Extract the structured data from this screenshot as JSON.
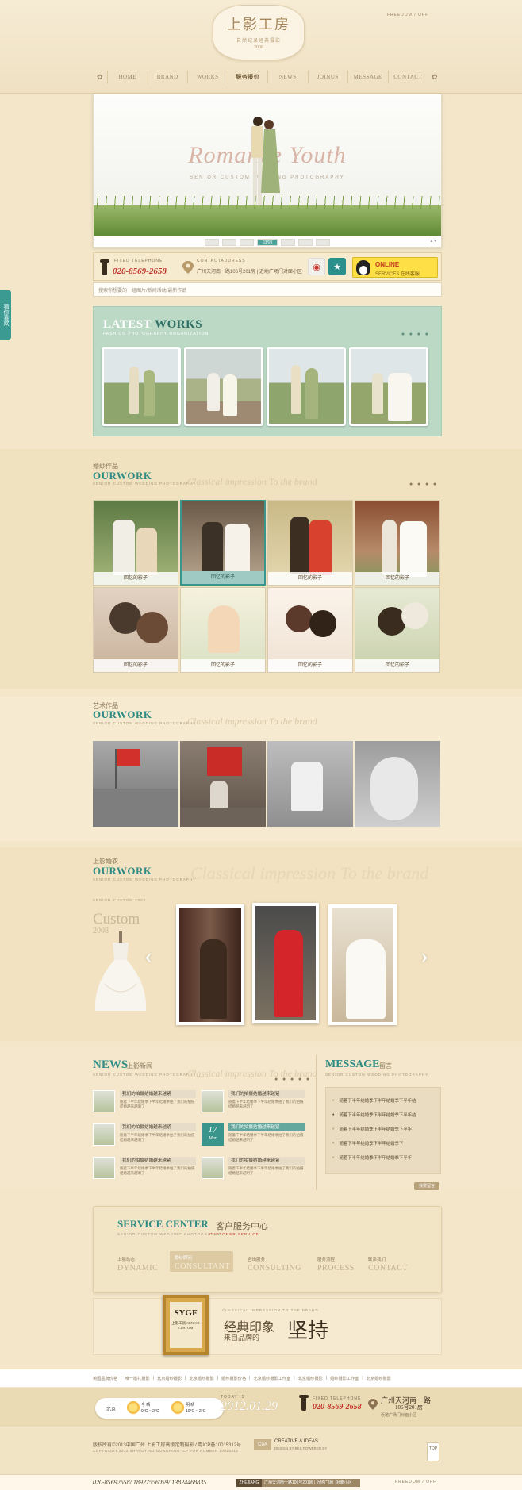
{
  "header": {
    "logo_title": "上影工房",
    "logo_subtitle": "自然纪录经典摄影",
    "logo_year": "2008",
    "lang": "FREEDOM / OFF"
  },
  "nav": {
    "left_icon": "home-deco-icon",
    "items": [
      {
        "label": "HOME"
      },
      {
        "label": "BRAND"
      },
      {
        "label": "WORKS"
      },
      {
        "label": "服务报价"
      },
      {
        "label": "NEWS"
      },
      {
        "label": "JOINUS"
      },
      {
        "label": "MESSAGE"
      },
      {
        "label": "CONTACT"
      }
    ],
    "right_icon": "flower-deco-icon"
  },
  "banner": {
    "headline": "Romance Youth",
    "subline": "SENIOR CUSTOM WEDDING PHOTOGRAPHY",
    "pager_current": "03/09"
  },
  "contact": {
    "phone_label": "FIXED TELEPHONE",
    "phone": "020-8569-2658",
    "addr_label": "CONTACTADDRESS",
    "addr": "广州天河南一路106号201房 | 近地广场门对面小区",
    "qq_line1": "ONLINE",
    "qq_line2": "SERVICES 在线客服"
  },
  "search": {
    "placeholder": "搜索你想要的一组图片/新闻活动/最新作品"
  },
  "latest": {
    "title_a": "LATEST",
    "title_b": "WORKS",
    "subtitle": "FASHION PHOTOGRAPHY ORGANIZATION"
  },
  "work1": {
    "cn": "婚纱作品",
    "en": "OURWORK",
    "sub": "SENIOR CUSTOM WEDDING PHOTOGRAPHY",
    "script": "Classical impression To the brand",
    "captions": [
      "回忆的影子",
      "回忆的影子",
      "回忆的影子",
      "回忆的影子",
      "回忆的影子",
      "回忆的影子",
      "回忆的影子",
      "回忆的影子"
    ]
  },
  "work2": {
    "cn": "艺术作品",
    "en": "OURWORK",
    "sub": "SENIOR CUSTOM WEDDING PHOTOGRAPHY",
    "script": "Classical impression To the brand"
  },
  "work3": {
    "cn": "上影婚衣",
    "en": "OURWORK",
    "sub": "SENIOR CUSTOM WEDDING PHOTOGRAPHY",
    "script": "Classical impression To the brand",
    "custom_label": "SENIOR CUSTOM 2008",
    "custom": "Custom",
    "custom_year": "2008"
  },
  "news": {
    "en": "NEWS",
    "cn": "上影新闻",
    "sub": "SENIOR CUSTOM WEDDING PHOTOGRAPHY",
    "script": "Classical impression To the brand",
    "item_title": "我们的拍摄结婚越来越紧",
    "highlight_title": "我们的拍摄结婚越来越紧",
    "item_desc": "随着下半年结婚季下半年结婚季拍了我们的拍摄结婚越来越明了",
    "date_day": "17",
    "date_mon": "Mar"
  },
  "message": {
    "en": "MESSAGE",
    "cn": "留言",
    "sub": "SENIOR CUSTOM WEDDING PHOTOGRAPHY",
    "rows": [
      "随着下半年结婚季下半年结婚季下半年结",
      "随着下半年结婚季下半年结婚季下半年结",
      "随着下半年结婚季下半年结婚季下半年",
      "随着下半年结婚季下半年结婚季下",
      "随着下半年结婚季下半年结婚季下半年"
    ],
    "button": "我要留言"
  },
  "service": {
    "en": "SERVICE CENTER",
    "cn": "客户服务中心",
    "sub": "SENIOR CUSTOM WEDDING PHOTOGRAPHY",
    "sub_red": "CUSTOMER SERVICE",
    "items": [
      {
        "cn": "上影动态",
        "en": "DYNAMIC"
      },
      {
        "cn": "婚纱顾问",
        "en": "CONSULTANT"
      },
      {
        "cn": "咨询服务",
        "en": "CONSULTING"
      },
      {
        "cn": "服务流程",
        "en": "PROCESS"
      },
      {
        "cn": "联系我们",
        "en": "CONTACT"
      }
    ]
  },
  "brand": {
    "plaque": "SYGF",
    "plaque_sub": "上影工房 SENIOR CUSTOM",
    "kicker": "CLASSICAL IMPRESSION TO THE BRAND",
    "line1": "经典印象",
    "line2": "来自品牌的",
    "big": "坚持"
  },
  "footer": {
    "links": [
      "英国品牌价格",
      "唯一婚礼摄影",
      "北京婚纱摄影",
      "北京婚纱摄影",
      "婚纱摄影价格",
      "北京婚纱摄影工作室",
      "北京婚纱摄影",
      "婚纱摄影工作室",
      "北京婚纱摄影"
    ],
    "weather_city": "北京",
    "w1_label": "今 晴",
    "w1_temp": "9°C ~ 2°C",
    "w2_label": "明 晴",
    "w2_temp": "10°C ~ 2°C",
    "today_label": "TODAY IS",
    "date": "2012.01.29",
    "phone_label": "FIXED TELEPHONE",
    "phone": "020-8569-2658",
    "addr_big": "广州天河南一路",
    "addr_big2": "106号201房",
    "addr_small": "近地广场门对面小区",
    "copyright": "版权所有©2013中国广州 上影工房高级定制摄影 / 粤ICP备10015312号",
    "copyright_en": "COPYRIGHT 2012 SHANGYING GONGFANG ICP FOR NUMBER 10015312",
    "credit_badge": "CoA",
    "credit_title": "CREATIVE & IDEAS",
    "credit_sub": "DESIGN BY BKS POWERED BY",
    "top_label": "TOP",
    "bottom_phones": "020-85692658/ 18927556059/ 13824468835",
    "bottom_badge": "ZHEJIANG",
    "bottom_addr": "广州天河南一路106号201房 | 近地广场门对面小区",
    "bottom_lang": "FREEDOM / OFF"
  },
  "side_tab": "猜你喜欢"
}
